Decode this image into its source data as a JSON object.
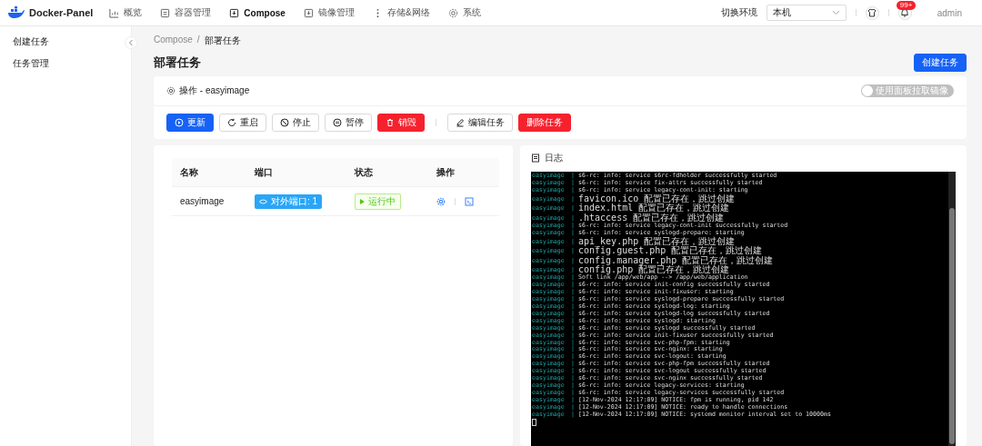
{
  "brand": "Docker-Panel",
  "nav": [
    {
      "label": "概览",
      "selected": false
    },
    {
      "label": "容器管理",
      "selected": false
    },
    {
      "label": "Compose",
      "selected": true
    },
    {
      "label": "镜像管理",
      "selected": false
    },
    {
      "label": "存储&网络",
      "selected": false
    },
    {
      "label": "系统",
      "selected": false
    }
  ],
  "env": {
    "label": "切换环境",
    "value": "本机"
  },
  "notifications": {
    "badge": "99+"
  },
  "user": "admin",
  "sidebar": {
    "items": [
      "创建任务",
      "任务管理"
    ]
  },
  "breadcrumb": {
    "items": [
      "Compose",
      "部署任务"
    ],
    "separator": "/"
  },
  "page_title": "部署任务",
  "create_button": "创建任务",
  "ops": {
    "title": "操作 - easyimage",
    "toggle": {
      "label": "使用面板拉取镜像",
      "checked": false
    },
    "buttons": [
      {
        "label": "更新",
        "kind": "primary",
        "gap_before": false
      },
      {
        "label": "重启",
        "kind": "default",
        "gap_before": false
      },
      {
        "label": "停止",
        "kind": "default",
        "gap_before": false
      },
      {
        "label": "暂停",
        "kind": "default",
        "gap_before": false
      },
      {
        "label": "销毁",
        "kind": "danger",
        "gap_before": false
      },
      {
        "label": "编辑任务",
        "kind": "default",
        "gap_before": true
      },
      {
        "label": "删除任务",
        "kind": "danger",
        "gap_before": false
      }
    ]
  },
  "table": {
    "columns": [
      "名称",
      "端口",
      "状态",
      "操作"
    ],
    "rows": [
      {
        "name": "easyimage",
        "port": "对外端口: 1",
        "status": "运行中"
      }
    ]
  },
  "log": {
    "title": "日志",
    "lines": [
      {
        "source": "easyimage",
        "sep": "|",
        "text": "s6-rc: info: service s6rc-fdholder successfully started"
      },
      {
        "source": "easyimage",
        "sep": "|",
        "text": "s6-rc: info: service fix-attrs successfully started"
      },
      {
        "source": "easyimage",
        "sep": "|",
        "text": "s6-rc: info: service legacy-cont-init: starting"
      },
      {
        "source": "easyimage",
        "sep": "|",
        "text": "favicon.ico 配置已存在，跳过创建"
      },
      {
        "source": "easyimage",
        "sep": "|",
        "text": "index.html 配置已存在，跳过创建"
      },
      {
        "source": "easyimage",
        "sep": "|",
        "text": ".htaccess 配置已存在，跳过创建"
      },
      {
        "source": "easyimage",
        "sep": "|",
        "text": "s6-rc: info: service legacy-cont-init successfully started"
      },
      {
        "source": "easyimage",
        "sep": "|",
        "text": "s6-rc: info: service syslogd-prepare: starting"
      },
      {
        "source": "easyimage",
        "sep": "|",
        "text": "api_key.php 配置已存在，跳过创建"
      },
      {
        "source": "easyimage",
        "sep": "|",
        "text": "config.guest.php 配置已存在，跳过创建"
      },
      {
        "source": "easyimage",
        "sep": "|",
        "text": "config.manager.php 配置已存在，跳过创建"
      },
      {
        "source": "easyimage",
        "sep": "|",
        "text": "config.php 配置已存在，跳过创建"
      },
      {
        "source": "easyimage",
        "sep": "|",
        "text": "Soft link /app/web/app --> /app/web/application"
      },
      {
        "source": "easyimage",
        "sep": "|",
        "text": "s6-rc: info: service init-config successfully started"
      },
      {
        "source": "easyimage",
        "sep": "|",
        "text": "s6-rc: info: service init-fixuser: starting"
      },
      {
        "source": "easyimage",
        "sep": "|",
        "text": "s6-rc: info: service syslogd-prepare successfully started"
      },
      {
        "source": "easyimage",
        "sep": "|",
        "text": "s6-rc: info: service syslogd-log: starting"
      },
      {
        "source": "easyimage",
        "sep": "|",
        "text": "s6-rc: info: service syslogd-log successfully started"
      },
      {
        "source": "easyimage",
        "sep": "|",
        "text": "s6-rc: info: service syslogd: starting"
      },
      {
        "source": "easyimage",
        "sep": "|",
        "text": "s6-rc: info: service syslogd successfully started"
      },
      {
        "source": "easyimage",
        "sep": "|",
        "text": "s6-rc: info: service init-fixuser successfully started"
      },
      {
        "source": "easyimage",
        "sep": "|",
        "text": "s6-rc: info: service svc-php-fpm: starting"
      },
      {
        "source": "easyimage",
        "sep": "|",
        "text": "s6-rc: info: service svc-nginx: starting"
      },
      {
        "source": "easyimage",
        "sep": "|",
        "text": "s6-rc: info: service svc-logout: starting"
      },
      {
        "source": "easyimage",
        "sep": "|",
        "text": "s6-rc: info: service svc-php-fpm successfully started"
      },
      {
        "source": "easyimage",
        "sep": "|",
        "text": "s6-rc: info: service svc-logout successfully started"
      },
      {
        "source": "easyimage",
        "sep": "|",
        "text": "s6-rc: info: service svc-nginx successfully started"
      },
      {
        "source": "easyimage",
        "sep": "|",
        "text": "s6-rc: info: service legacy-services: starting"
      },
      {
        "source": "easyimage",
        "sep": "|",
        "text": "s6-rc: info: service legacy-services successfully started"
      },
      {
        "source": "easyimage",
        "sep": "|",
        "text": "[12-Nov-2024 12:17:09] NOTICE: fpm is running, pid 142"
      },
      {
        "source": "easyimage",
        "sep": "|",
        "text": "[12-Nov-2024 12:17:09] NOTICE: ready to handle connections"
      },
      {
        "source": "easyimage",
        "sep": "|",
        "text": "[12-Nov-2024 12:17:09] NOTICE: systemd monitor interval set to 10000ms"
      }
    ]
  }
}
